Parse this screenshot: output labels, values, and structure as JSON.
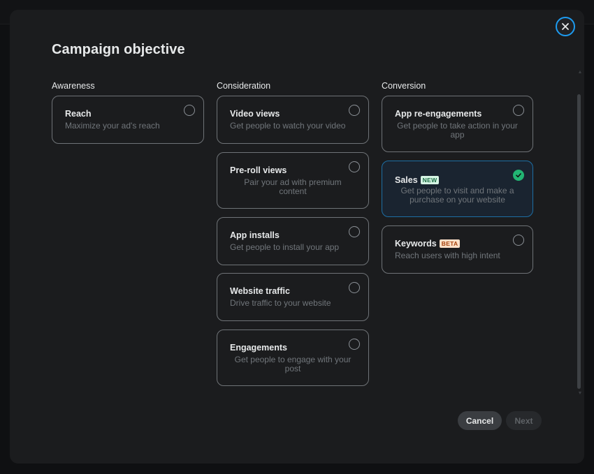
{
  "modal": {
    "title": "Campaign objective",
    "close_icon": "close-icon"
  },
  "columns": [
    {
      "label": "Awareness",
      "cards": [
        {
          "name": "Reach",
          "desc": "Maximize your ad's reach",
          "selected": false
        }
      ]
    },
    {
      "label": "Consideration",
      "cards": [
        {
          "name": "Video views",
          "desc": "Get people to watch your video",
          "selected": false
        },
        {
          "name": "Pre-roll views",
          "desc": "Pair your ad with premium content",
          "selected": false
        },
        {
          "name": "App installs",
          "desc": "Get people to install your app",
          "selected": false
        },
        {
          "name": "Website traffic",
          "desc": "Drive traffic to your website",
          "selected": false
        },
        {
          "name": "Engagements",
          "desc": "Get people to engage with your post",
          "selected": false
        }
      ]
    },
    {
      "label": "Conversion",
      "cards": [
        {
          "name": "App re-engagements",
          "desc": "Get people to take action in your app",
          "selected": false
        },
        {
          "name": "Sales",
          "badge": "NEW",
          "desc": "Get people to visit and make a purchase on your website",
          "selected": true
        },
        {
          "name": "Keywords",
          "badge": "BETA",
          "desc": "Reach users with high intent",
          "selected": false
        }
      ]
    }
  ],
  "footer": {
    "cancel_label": "Cancel",
    "next_label": "Next"
  },
  "colors": {
    "accent": "#1d9bf0",
    "selected_check": "#22b573",
    "modal_bg": "#1b1c1e"
  }
}
